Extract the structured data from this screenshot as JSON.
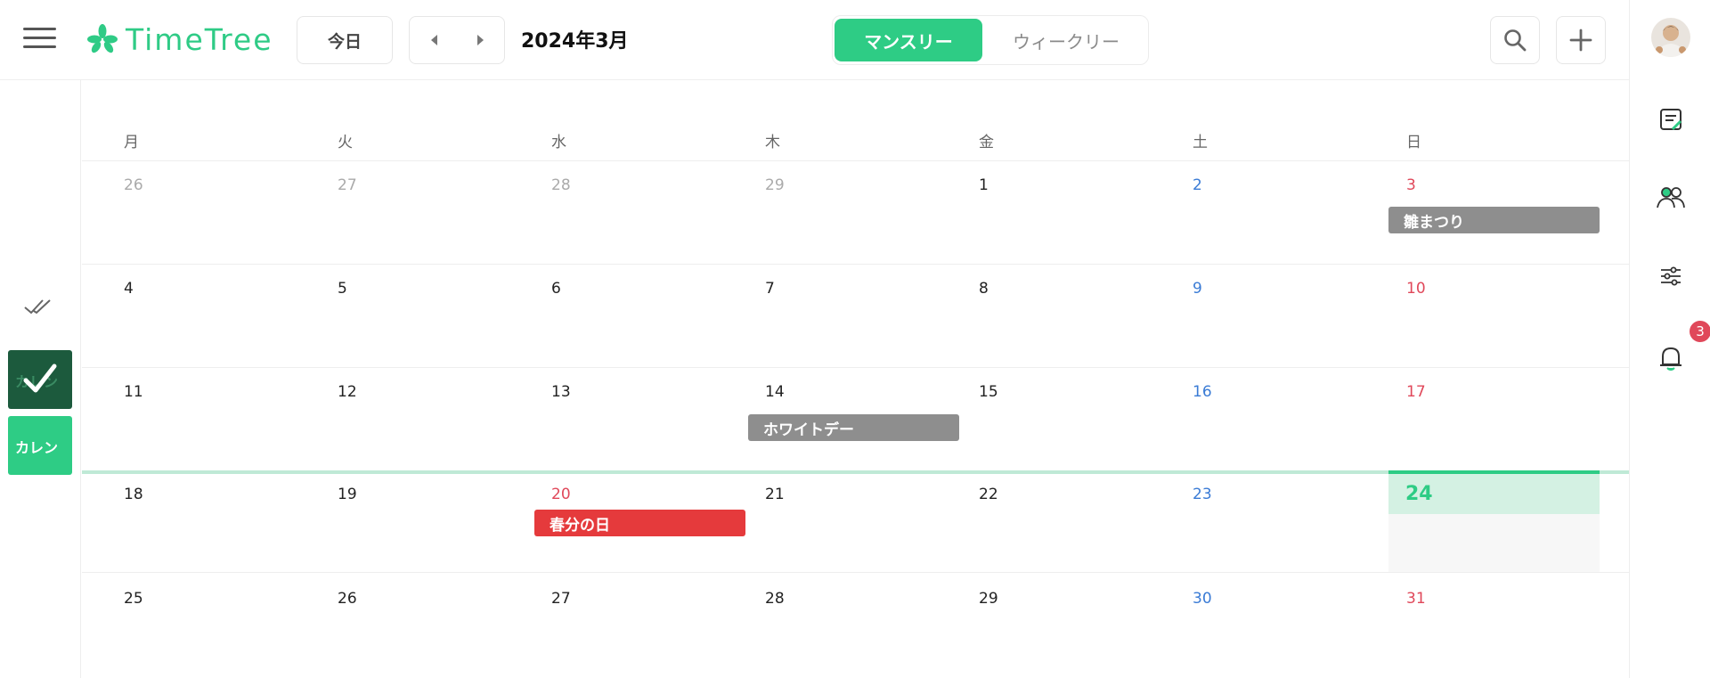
{
  "header": {
    "app_name": "TimeTree",
    "today_label": "今日",
    "month_title": "2024年3月",
    "view_monthly": "マンスリー",
    "view_weekly": "ウィークリー"
  },
  "calendars": [
    "カレン",
    "カレン"
  ],
  "notifications": {
    "count": "3"
  },
  "weekdays": [
    "月",
    "火",
    "水",
    "木",
    "金",
    "土",
    "日"
  ],
  "weeks": [
    {
      "days": [
        "26",
        "27",
        "28",
        "29",
        "1",
        "2",
        "3"
      ]
    },
    {
      "days": [
        "4",
        "5",
        "6",
        "7",
        "8",
        "9",
        "10"
      ]
    },
    {
      "days": [
        "11",
        "12",
        "13",
        "14",
        "15",
        "16",
        "17"
      ]
    },
    {
      "days": [
        "18",
        "19",
        "20",
        "21",
        "22",
        "23",
        "24"
      ]
    },
    {
      "days": [
        "25",
        "26",
        "27",
        "28",
        "29",
        "30",
        "31"
      ]
    }
  ],
  "events": {
    "hinamatsuri": "雛まつり",
    "white_day": "ホワイトデー",
    "shunbun": "春分の日"
  },
  "colors": {
    "accent": "#2ecc85",
    "saturday": "#3a7bd5",
    "sunday_holiday": "#e0485a",
    "event_gray": "#8e8e8e",
    "event_red": "#e53a3c"
  }
}
